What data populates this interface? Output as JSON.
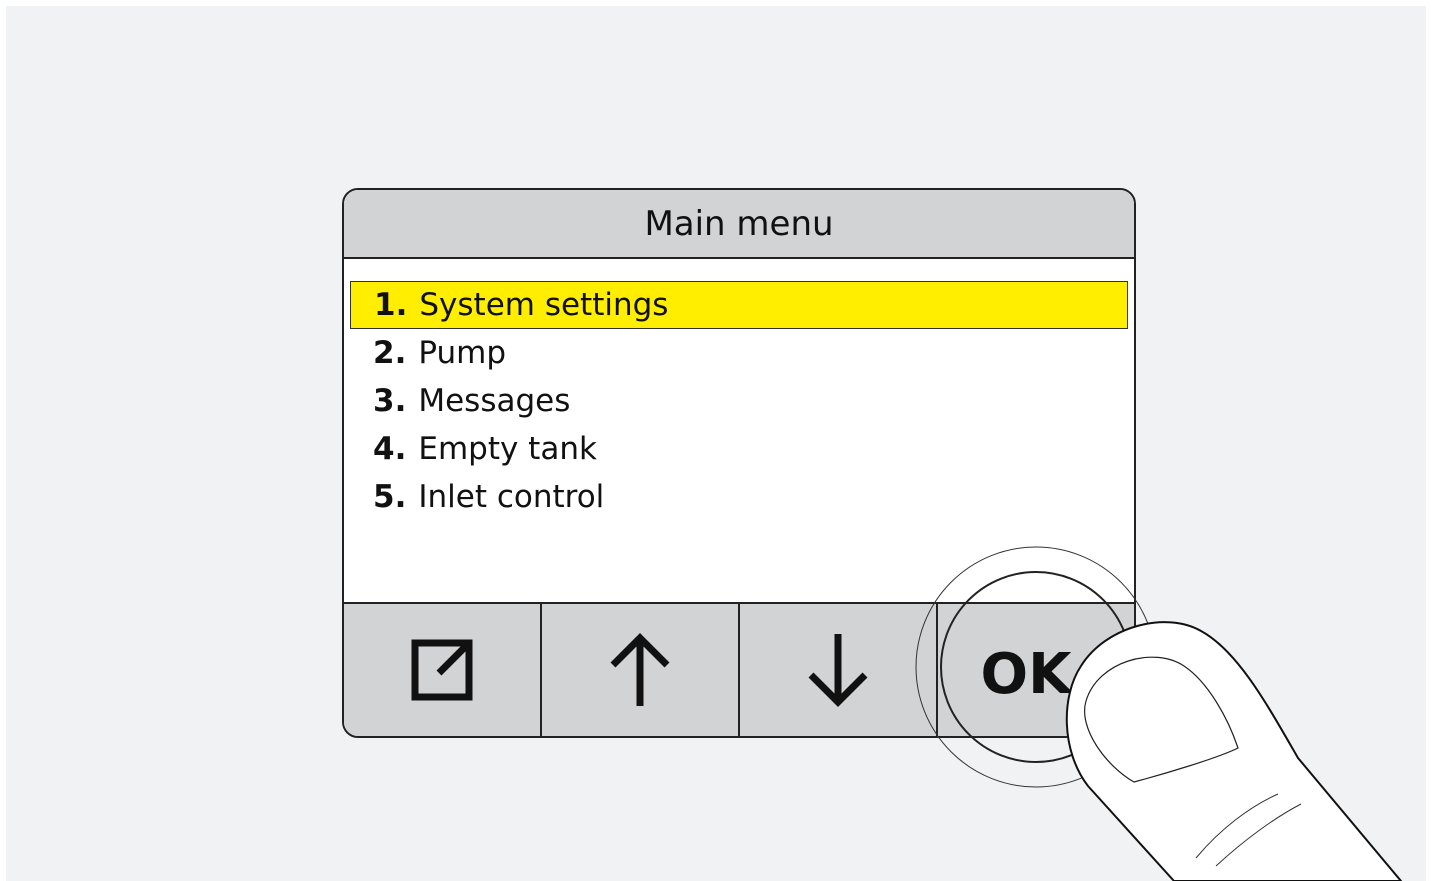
{
  "screen": {
    "title": "Main menu"
  },
  "menu": {
    "items": [
      {
        "number": "1.",
        "label": "System settings",
        "selected": true
      },
      {
        "number": "2.",
        "label": "Pump",
        "selected": false
      },
      {
        "number": "3.",
        "label": "Messages",
        "selected": false
      },
      {
        "number": "4.",
        "label": "Empty tank",
        "selected": false
      },
      {
        "number": "5.",
        "label": "Inlet control",
        "selected": false
      }
    ]
  },
  "softkeys": {
    "exit_icon": "exit-icon",
    "up_icon": "arrow-up-icon",
    "down_icon": "arrow-down-icon",
    "ok_label": "OK"
  },
  "colors": {
    "selection_highlight": "#ffee00",
    "panel_gray": "#d2d3d5",
    "background": "#f1f2f4"
  }
}
